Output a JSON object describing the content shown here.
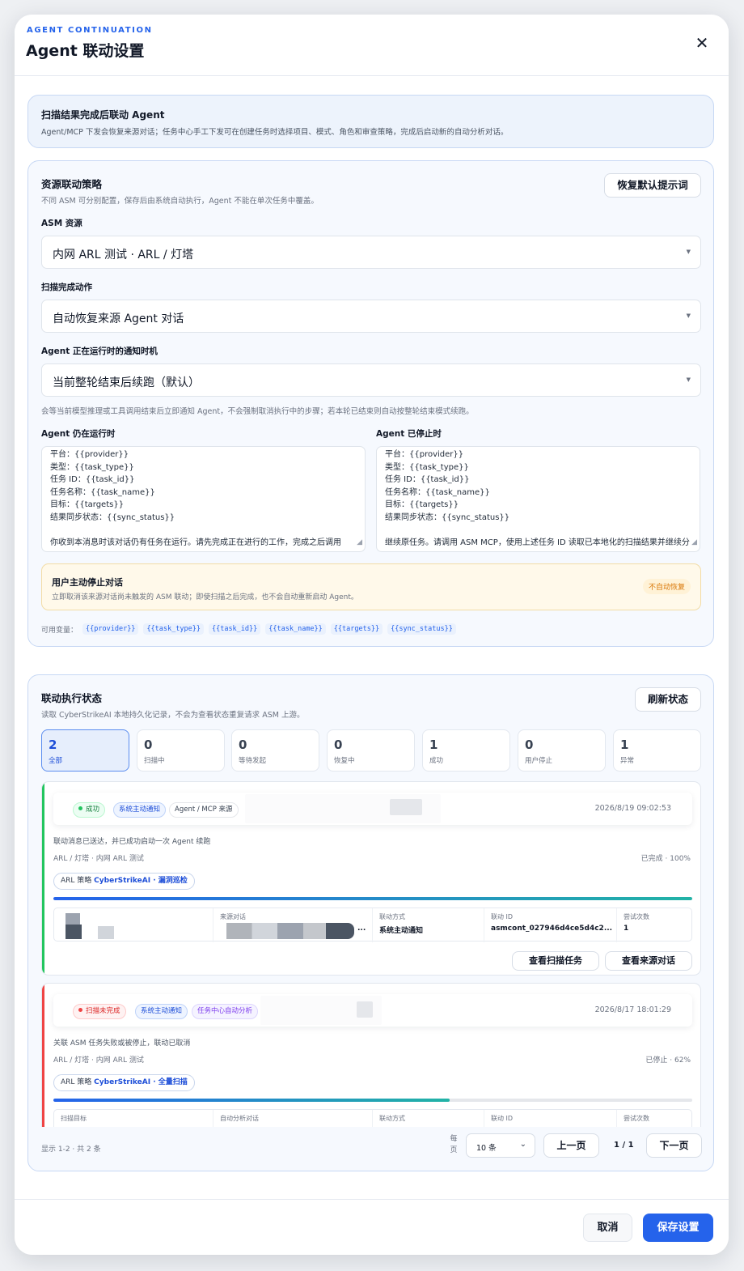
{
  "header": {
    "eyebrow": "AGENT CONTINUATION",
    "title": "Agent 联动设置",
    "close_glyph": "✕"
  },
  "info": {
    "title": "扫描结果完成后联动 Agent",
    "desc": "Agent/MCP 下发会恢复来源对话；任务中心手工下发可在创建任务时选择项目、模式、角色和审查策略，完成后启动新的自动分析对话。"
  },
  "policy": {
    "title": "资源联动策略",
    "desc": "不同 ASM 可分别配置，保存后由系统自动执行，Agent 不能在单次任务中覆盖。",
    "restore_button": "恢复默认提示词",
    "asm_label": "ASM 资源",
    "asm_value": "内网 ARL 测试 · ARL / 灯塔",
    "action_label": "扫描完成动作",
    "action_value": "自动恢复来源 Agent 对话",
    "timing_label": "Agent 正在运行时的通知时机",
    "timing_value": "当前整轮结束后续跑（默认）",
    "timing_hint": "会等当前模型推理或工具调用结束后立即通知 Agent，不会强制取消执行中的步骤；若本轮已结束则自动按整轮结束模式续跑。",
    "running_label": "Agent 仍在运行时",
    "stopped_label": "Agent 已停止时",
    "running_lines": [
      "平台：{{provider}}",
      "类型：{{task_type}}",
      "任务 ID：{{task_id}}",
      "任务名称：{{task_name}}",
      "目标：{{targets}}",
      "结果同步状态：{{sync_status}}",
      "",
      "你收到本消息时该对话仍有任务在运行。请先完成正在进行的工作，完成之后调用"
    ],
    "stopped_lines": [
      "平台：{{provider}}",
      "类型：{{task_type}}",
      "任务 ID：{{task_id}}",
      "任务名称：{{task_name}}",
      "目标：{{targets}}",
      "结果同步状态：{{sync_status}}",
      "",
      "继续原任务。请调用 ASM MCP，使用上述任务 ID 读取已本地化的扫描结果并继续分"
    ],
    "stop_title": "用户主动停止对话",
    "stop_desc": "立即取消该来源对话尚未触发的 ASM 联动；即使扫描之后完成，也不会自动重新启动 Agent。",
    "stop_badge": "不自动恢复",
    "vars_label": "可用变量：",
    "vars": [
      "{{provider}}",
      "{{task_type}}",
      "{{task_id}}",
      "{{task_name}}",
      "{{targets}}",
      "{{sync_status}}"
    ]
  },
  "status": {
    "title": "联动执行状态",
    "desc": "读取 CyberStrikeAI 本地持久化记录，不会为查看状态重复请求 ASM 上游。",
    "refresh_button": "刷新状态",
    "tiles": [
      {
        "num": "2",
        "label": "全部"
      },
      {
        "num": "0",
        "label": "扫描中"
      },
      {
        "num": "0",
        "label": "等待发起"
      },
      {
        "num": "0",
        "label": "恢复中"
      },
      {
        "num": "1",
        "label": "成功"
      },
      {
        "num": "0",
        "label": "用户停止"
      },
      {
        "num": "1",
        "label": "异常"
      }
    ],
    "runs": [
      {
        "status": "成功",
        "chip2": "系统主动通知",
        "chip3": "Agent / MCP 来源",
        "time": "2026/8/19 09:02:53",
        "message": "联动消息已送达，并已成功启动一次 Agent 续跑",
        "source": "ARL / 灯塔 · 内网 ARL 测试",
        "progress_text": "已完成 · 100%",
        "progress": 1.0,
        "policy_prefix": "ARL 策略",
        "policy_name": "CyberStrikeAI · 漏洞巡检",
        "meta": [
          {
            "k": "",
            "v": ""
          },
          {
            "k": "来源对话",
            "v": "..."
          },
          {
            "k": "联动方式",
            "v": "系统主动通知"
          },
          {
            "k": "联动 ID",
            "v": "asmcont_027946d4ce5d4c2..."
          },
          {
            "k": "尝试次数",
            "v": "1"
          }
        ],
        "btn1": "查看扫描任务",
        "btn2": "查看来源对话"
      },
      {
        "status": "扫描未完成",
        "chip2": "系统主动通知",
        "chip3": "任务中心自动分析",
        "time": "2026/8/17 18:01:29",
        "message": "关联 ASM 任务失败或被停止，联动已取消",
        "source": "ARL / 灯塔 · 内网 ARL 测试",
        "progress_text": "已停止 · 62%",
        "progress": 0.62,
        "policy_prefix": "ARL 策略",
        "policy_name": "CyberStrikeAI · 全量扫描",
        "meta": [
          {
            "k": "扫描目标",
            "v": ""
          },
          {
            "k": "自动分析对话",
            "v": ""
          },
          {
            "k": "联动方式",
            "v": ""
          },
          {
            "k": "联动 ID",
            "v": ""
          },
          {
            "k": "尝试次数",
            "v": ""
          }
        ]
      }
    ],
    "pager": {
      "info": "显示 1-2 · 共 2 条",
      "per_label": "每页",
      "per_value": "10 条",
      "prev": "上一页",
      "page": "1 / 1",
      "next": "下一页"
    }
  },
  "footer": {
    "cancel": "取消",
    "save": "保存设置"
  },
  "colors": {
    "accent": "#2563eb",
    "success": "#16a34a",
    "danger": "#dc2626",
    "warning": "#d97706"
  }
}
